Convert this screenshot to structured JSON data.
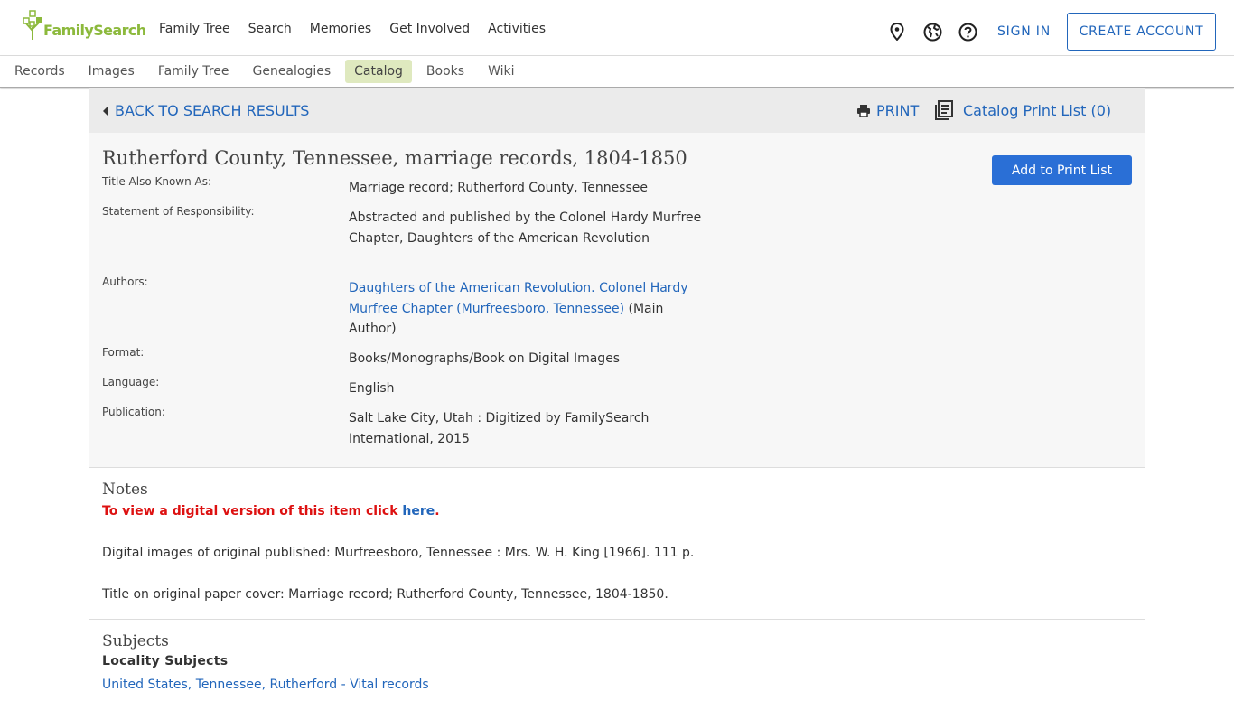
{
  "brand": {
    "name": "FamilySearch",
    "color": "#8cb93c"
  },
  "main_nav": [
    "Family Tree",
    "Search",
    "Memories",
    "Get Involved",
    "Activities"
  ],
  "header_icons": [
    "location-pin-icon",
    "globe-icon",
    "help-icon"
  ],
  "auth": {
    "sign_in": "SIGN IN",
    "create_account": "CREATE ACCOUNT"
  },
  "sub_nav": {
    "items": [
      "Records",
      "Images",
      "Family Tree",
      "Genealogies",
      "Catalog",
      "Books",
      "Wiki"
    ],
    "active": "Catalog"
  },
  "toolbar": {
    "back": "BACK TO SEARCH RESULTS",
    "print": "PRINT",
    "catalog_print_list": "Catalog Print List (0)"
  },
  "record": {
    "title": "Rutherford County, Tennessee, marriage records, 1804-1850",
    "add_button": "Add to Print List",
    "fields": {
      "aka_label": "Title Also Known As:",
      "aka_value": "Marriage record; Rutherford County, Tennessee",
      "responsibility_label": "Statement of Responsibility:",
      "responsibility_value": "Abstracted and published by the Colonel Hardy Murfree Chapter, Daughters of the American Revolution",
      "authors_label": "Authors:",
      "authors_link": "Daughters of the American Revolution. Colonel Hardy Murfree Chapter (Murfreesboro, Tennessee)",
      "authors_suffix": " (Main Author)",
      "format_label": "Format:",
      "format_value": "Books/Monographs/Book on Digital Images",
      "language_label": "Language:",
      "language_value": "English",
      "publication_label": "Publication:",
      "publication_value": "Salt Lake City, Utah : Digitized by FamilySearch International, 2015"
    }
  },
  "notes": {
    "heading": "Notes",
    "digital_prefix": "To view a digital version of this item click ",
    "digital_link": "here",
    "digital_suffix": ".",
    "note1": "Digital images of original published: Murfreesboro, Tennessee : Mrs. W. H. King [1966]. 111 p.",
    "note2": "Title on original paper cover: Marriage record; Rutherford County, Tennessee, 1804-1850."
  },
  "subjects": {
    "heading": "Subjects",
    "locality_heading": "Locality Subjects",
    "locality_items": [
      "United States, Tennessee, Rutherford - Vital records"
    ]
  },
  "colors": {
    "link": "#2266bb",
    "button": "#2a6fd6",
    "alert": "#dd1111",
    "active_tab": "#dfe9bf"
  }
}
